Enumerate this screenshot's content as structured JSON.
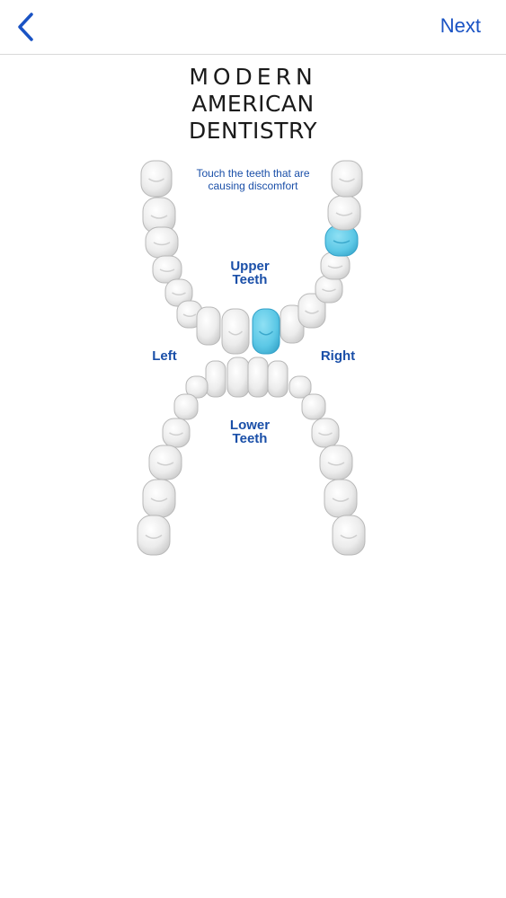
{
  "nav": {
    "back_icon": "chevron-left-icon",
    "next_label": "Next",
    "accent_color": "#1a53c4"
  },
  "brand": {
    "line1": "MODERN",
    "line2": "AMERICAN",
    "line3": "DENTISTRY"
  },
  "chart": {
    "instruction_line1": "Touch the teeth that are",
    "instruction_line2": "causing discomfort",
    "upper_label_line1": "Upper",
    "upper_label_line2": "Teeth",
    "lower_label_line1": "Lower",
    "lower_label_line2": "Teeth",
    "left_label": "Left",
    "right_label": "Right",
    "selected_color": "#5cc8e6",
    "tooth_color": "#efefef",
    "upper_selected": [
      8,
      13
    ],
    "lower_selected": []
  }
}
